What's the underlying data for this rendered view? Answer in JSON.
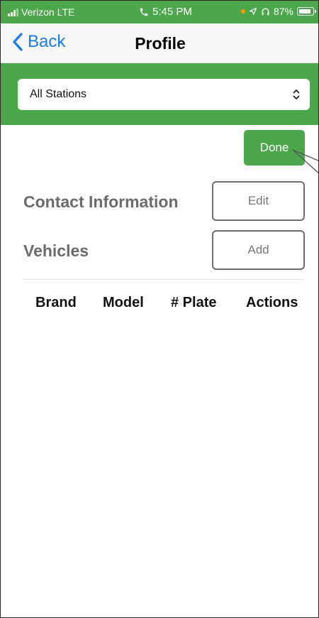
{
  "status_bar": {
    "carrier": "Verizon",
    "network": "LTE",
    "time": "5:45 PM",
    "battery": "87%",
    "background": "#4ca64c"
  },
  "nav": {
    "back_label": "Back",
    "title": "Profile",
    "accent": "#1a7cf5"
  },
  "station_selector": {
    "value": "All Stations"
  },
  "actions": {
    "done_label": "Done"
  },
  "contact": {
    "title": "Contact Information",
    "edit_label": "Edit"
  },
  "vehicles": {
    "title": "Vehicles",
    "add_label": "Add",
    "columns": [
      "Brand",
      "Model",
      "# Plate",
      "Actions"
    ]
  },
  "colors": {
    "brand_green": "#4ca64c",
    "section_gray": "#6b6b6b"
  }
}
